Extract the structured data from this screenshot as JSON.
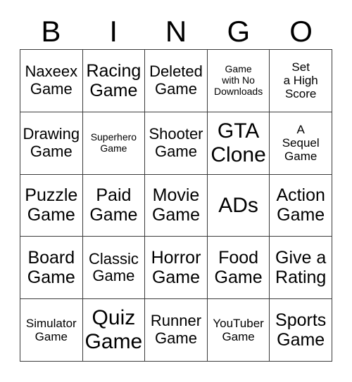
{
  "card": {
    "title": "BINGO",
    "columns": [
      "B",
      "I",
      "N",
      "G",
      "O"
    ],
    "rows": [
      [
        {
          "text": "Naxeex\nGame",
          "size": "md"
        },
        {
          "text": "Racing\nGame",
          "size": "lg"
        },
        {
          "text": "Deleted\nGame",
          "size": "md"
        },
        {
          "text": "Game\nwith No\nDownloads",
          "size": "xs"
        },
        {
          "text": "Set\na High\nScore",
          "size": "sm"
        }
      ],
      [
        {
          "text": "Drawing\nGame",
          "size": "md"
        },
        {
          "text": "Superhero\nGame",
          "size": "xs"
        },
        {
          "text": "Shooter\nGame",
          "size": "md"
        },
        {
          "text": "GTA\nClone",
          "size": "xl"
        },
        {
          "text": "A\nSequel\nGame",
          "size": "sm"
        }
      ],
      [
        {
          "text": "Puzzle\nGame",
          "size": "lg"
        },
        {
          "text": "Paid\nGame",
          "size": "lg"
        },
        {
          "text": "Movie\nGame",
          "size": "lg"
        },
        {
          "text": "ADs",
          "size": "xl"
        },
        {
          "text": "Action\nGame",
          "size": "lg"
        }
      ],
      [
        {
          "text": "Board\nGame",
          "size": "lg"
        },
        {
          "text": "Classic\nGame",
          "size": "md"
        },
        {
          "text": "Horror\nGame",
          "size": "lg"
        },
        {
          "text": "Food\nGame",
          "size": "lg"
        },
        {
          "text": "Give a\nRating",
          "size": "lg"
        }
      ],
      [
        {
          "text": "Simulator\nGame",
          "size": "sm"
        },
        {
          "text": "Quiz\nGame",
          "size": "xl"
        },
        {
          "text": "Runner\nGame",
          "size": "md"
        },
        {
          "text": "YouTuber\nGame",
          "size": "sm"
        },
        {
          "text": "Sports\nGame",
          "size": "lg"
        }
      ]
    ]
  },
  "colors": {
    "background": "#ffffff",
    "text": "#000000",
    "grid_line": "#3a3a3a"
  }
}
